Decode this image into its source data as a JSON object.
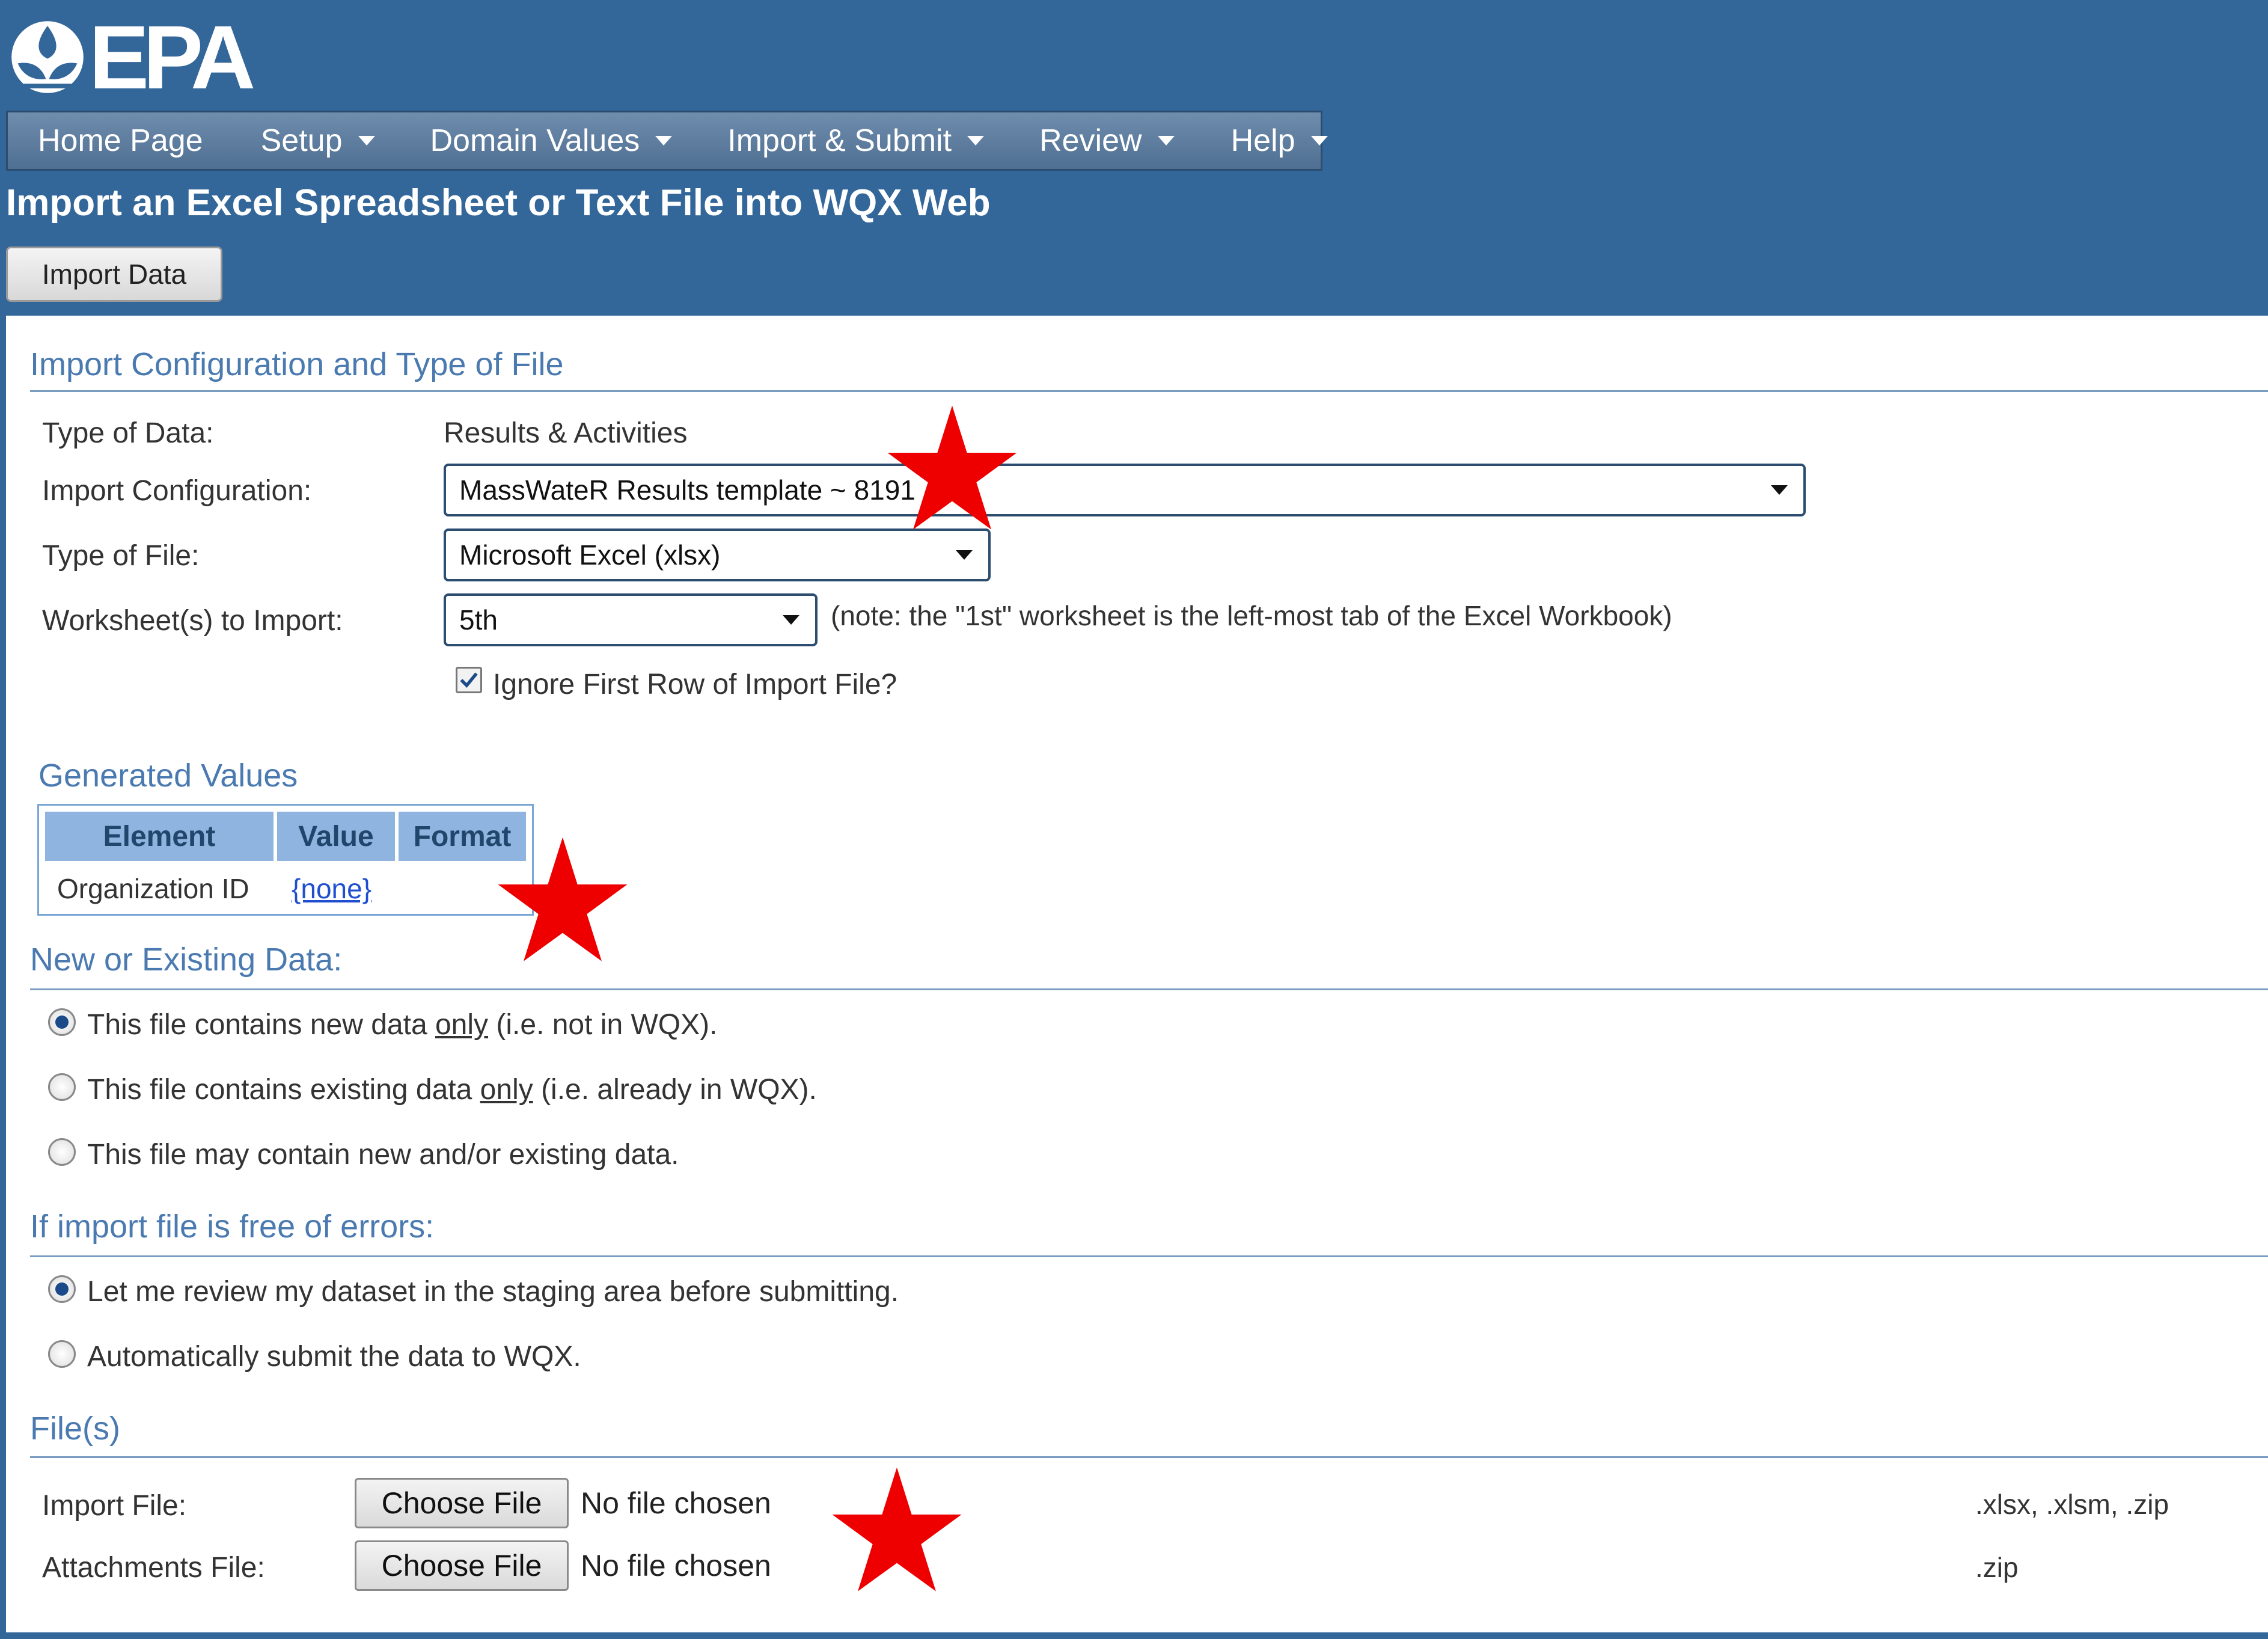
{
  "header": {
    "logo_text": "EPA",
    "nav": [
      {
        "label": "Home Page",
        "has_menu": false
      },
      {
        "label": "Setup",
        "has_menu": true
      },
      {
        "label": "Domain Values",
        "has_menu": true
      },
      {
        "label": "Import & Submit",
        "has_menu": true
      },
      {
        "label": "Review",
        "has_menu": true
      },
      {
        "label": "Help",
        "has_menu": true
      }
    ],
    "page_title": "Import an Excel Spreadsheet or Text File into WQX Web",
    "import_button": "Import Data"
  },
  "config": {
    "section_title": "Import Configuration and Type of File",
    "type_of_data_label": "Type of Data:",
    "type_of_data_value": "Results & Activities",
    "import_config_label": "Import Configuration:",
    "import_config_value": "MassWateR Results template ~ 8191",
    "file_type_label": "Type of File:",
    "file_type_value": "Microsoft Excel (xlsx)",
    "worksheet_label": "Worksheet(s) to Import:",
    "worksheet_value": "5th",
    "worksheet_note": "(note: the \"1st\" worksheet is the left-most tab of the Excel Workbook)",
    "ignore_first_row_label": "Ignore First Row of Import File?",
    "ignore_first_row_checked": true
  },
  "generated": {
    "title": "Generated Values",
    "columns": [
      "Element",
      "Value",
      "Format"
    ],
    "rows": [
      {
        "element": "Organization ID",
        "value": "{none}",
        "format": ""
      }
    ]
  },
  "new_existing": {
    "title": "New or Existing Data:",
    "options": [
      {
        "pre": "This file contains new data ",
        "em": "only",
        "post": " (i.e. not in WQX).",
        "selected": true
      },
      {
        "pre": "This file contains existing data ",
        "em": "only",
        "post": " (i.e. already in WQX).",
        "selected": false
      },
      {
        "pre": "This file may contain new and/or existing data.",
        "em": "",
        "post": "",
        "selected": false
      }
    ]
  },
  "errors_free": {
    "title": "If import file is free of errors:",
    "options": [
      {
        "label": "Let me review my dataset in the staging area before submitting.",
        "selected": true
      },
      {
        "label": "Automatically submit the data to WQX.",
        "selected": false
      }
    ]
  },
  "files": {
    "title": "File(s)",
    "import_label": "Import File:",
    "attachments_label": "Attachments File:",
    "choose_label": "Choose File",
    "no_file_text": "No file chosen",
    "import_ext": ".xlsx, .xlsm, .zip",
    "attachments_ext": ".zip"
  },
  "colors": {
    "brand_blue": "#336699",
    "section_text": "#4a7ab0",
    "star_red": "#ee0000"
  }
}
